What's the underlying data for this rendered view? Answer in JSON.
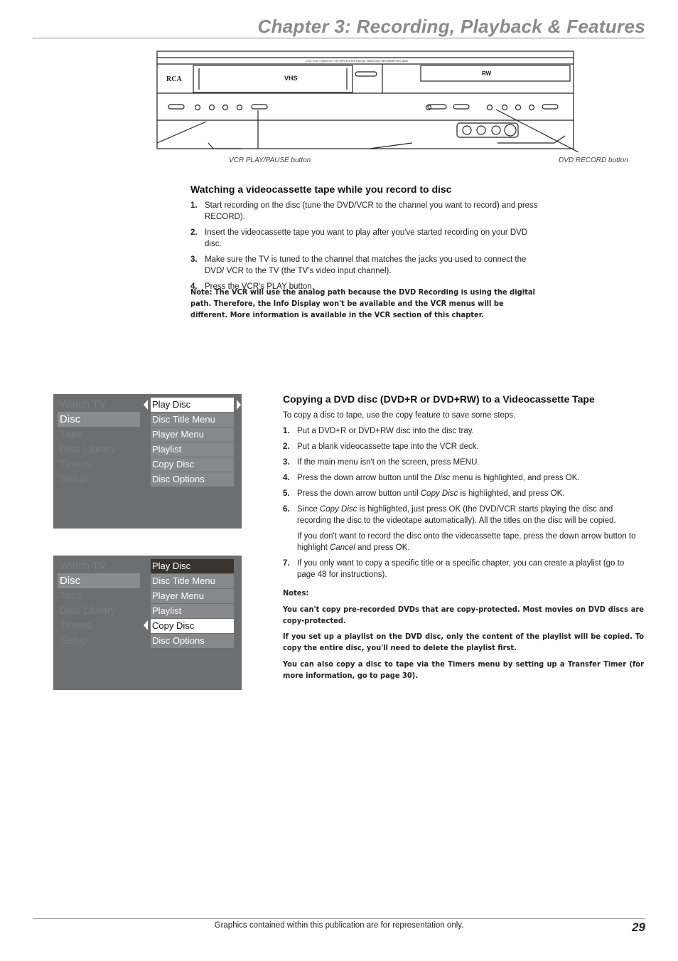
{
  "header": {
    "chapter_title": "Chapter 3: Recording, Playback & Features"
  },
  "figure": {
    "device_label": "DVD / VCR / VIDEO CD / CD / MP3 PLAYER   DIGITAL VIDEO DISC RECORDER   DRC 8300",
    "brand": "RCA",
    "vhs_logo": "VHS",
    "rw_logo": "RW",
    "caption_left": "VCR PLAY/PAUSE button",
    "caption_right": "DVD RECORD button"
  },
  "section1": {
    "heading": "Watching a videocassette tape while you record to disc",
    "steps": [
      {
        "n": "1.",
        "text": "Start recording on the disc (tune the DVD/VCR to the channel you want to record) and press RECORD)."
      },
      {
        "n": "2.",
        "text": "Insert the videocassette tape you want to play after you've started recording on your DVD disc."
      },
      {
        "n": "3.",
        "text": "Make sure the TV is tuned to the channel that matches the jacks you used to connect the DVD/ VCR to the TV (the TV's video input channel)."
      },
      {
        "n": "4.",
        "text": "Press the VCR's PLAY button."
      }
    ],
    "note": "Note: The VCR will use the analog path because the DVD Recording is using the digital path. Therefore, the Info Display won't be available and the VCR menus will be different. More information is available in the VCR section of this chapter."
  },
  "menu1": {
    "left": [
      "Watch TV",
      "Disc",
      "Tape",
      "Disc Library",
      "Timers",
      "Setup"
    ],
    "right": [
      "Play Disc",
      "Disc Title Menu",
      "Player Menu",
      "Playlist",
      "Copy Disc",
      "Disc Options"
    ],
    "selected_left": "Disc",
    "highlighted": "Play Disc"
  },
  "menu2": {
    "left": [
      "Watch TV",
      "Disc",
      "Tape",
      "Disc Library",
      "Timers",
      "Setup"
    ],
    "right": [
      "Play Disc",
      "Disc Title Menu",
      "Player Menu",
      "Playlist",
      "Copy Disc",
      "Disc Options"
    ],
    "selected_left": "Disc",
    "highlighted": "Copy Disc"
  },
  "section2": {
    "heading": "Copying a DVD disc (DVD+R or DVD+RW) to a Videocassette Tape",
    "intro": "To copy a disc to tape, use the copy feature to save some steps.",
    "steps": [
      {
        "n": "1.",
        "text": "Put a DVD+R or DVD+RW disc into the disc tray."
      },
      {
        "n": "2.",
        "text": "Put a blank videocassette tape into the VCR deck."
      },
      {
        "n": "3.",
        "text": "If the main menu isn't on the screen, press MENU."
      },
      {
        "n": "4.",
        "text_a": "Press the down arrow button until the ",
        "em": "Disc",
        "text_b": " menu is highlighted, and press OK."
      },
      {
        "n": "5.",
        "text_a": "Press the down arrow button until ",
        "em": "Copy Disc",
        "text_b": " is highlighted, and press OK."
      },
      {
        "n": "6.",
        "text_a": "Since ",
        "em": "Copy Disc",
        "text_b": " is highlighted, just press OK (the DVD/VCR starts playing the disc and recording the disc to the videotape automatically). All the titles on the disc will be copied.",
        "sub_a": "If you don't want to record the disc onto the videcassette tape, press the down arrow button to highlight ",
        "sub_em": "Cancel",
        "sub_b": " and press OK."
      },
      {
        "n": "7.",
        "text": "If you only want to copy a specific title or a specific chapter, you can create a playlist (go to page 48 for instructions)."
      }
    ],
    "notes_label": "Notes:",
    "notes": [
      "You can't copy pre-recorded DVDs that are copy-protected. Most movies on DVD discs are copy-protected.",
      "If you set up a playlist on the DVD disc, only the content of the playlist will be copied. To copy the entire disc, you'll need to delete the playlist first.",
      "You can also copy a disc to tape via the Timers menu by setting up a Transfer Timer (for more information, go to page 30)."
    ]
  },
  "footer": {
    "text": "Graphics contained within this publication are for representation only.",
    "page_number": "29"
  }
}
